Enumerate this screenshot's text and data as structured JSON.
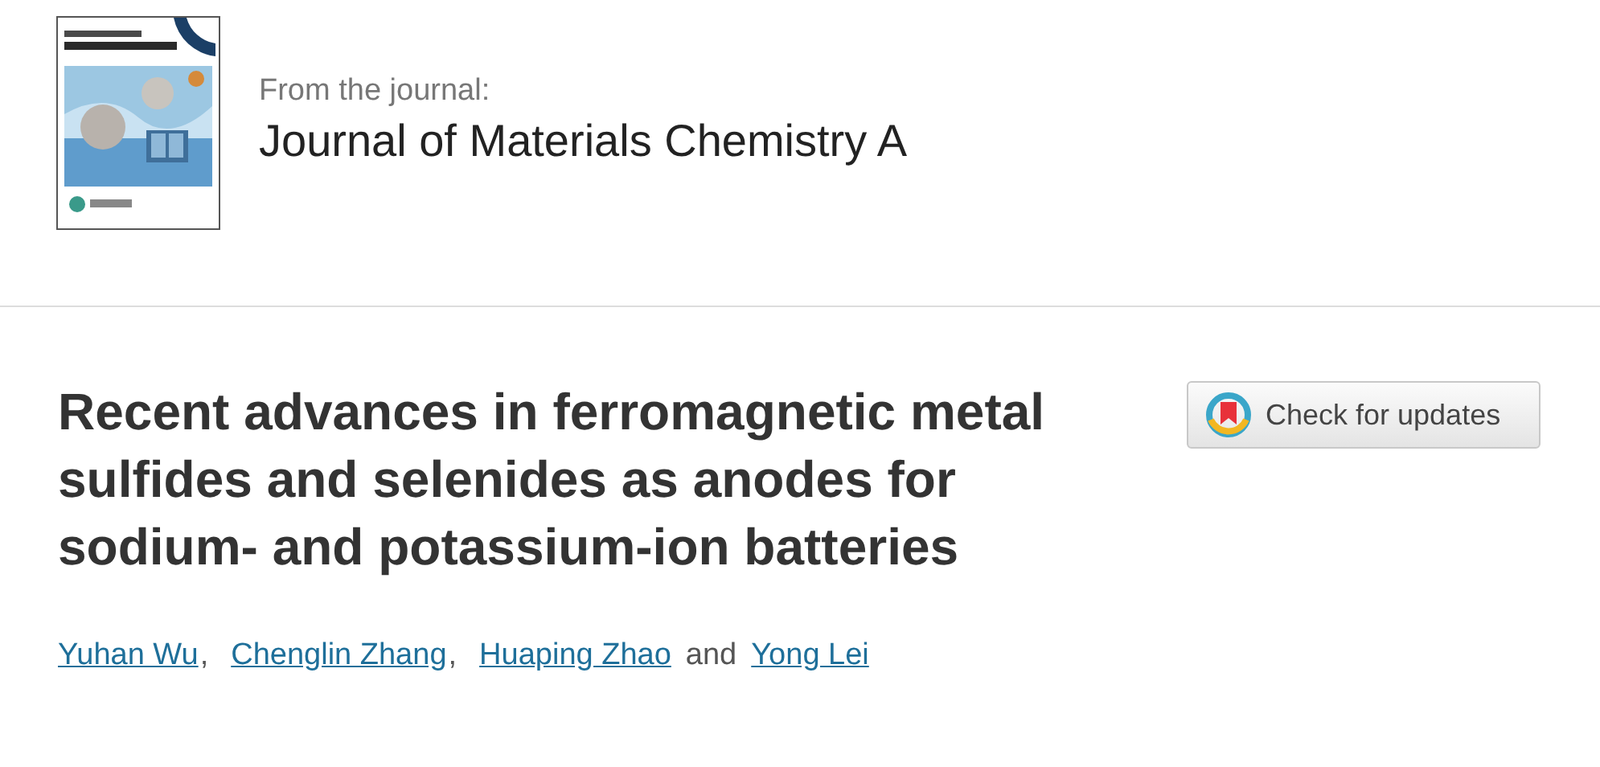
{
  "journal": {
    "label": "From the journal:",
    "name": "Journal of Materials Chemistry A"
  },
  "article": {
    "title": "Recent advances in ferromagnetic metal sulfides and selenides as anodes for sodium- and potassium-ion batteries",
    "updates_button": "Check for updates",
    "authors": [
      {
        "name": "Yuhan Wu",
        "after": ","
      },
      {
        "name": "Chenglin Zhang",
        "after": ","
      },
      {
        "name": "Huaping Zhao",
        "after": "and"
      },
      {
        "name": "Yong Lei"
      }
    ]
  }
}
